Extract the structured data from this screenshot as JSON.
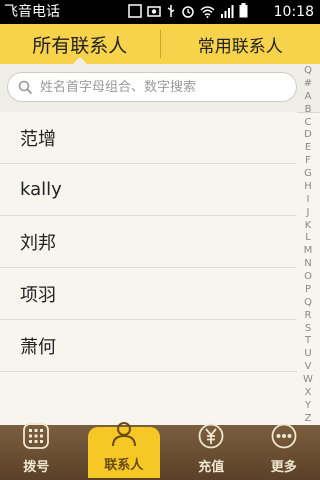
{
  "status_bar": {
    "carrier": "飞音电话",
    "time": "10:18",
    "icons": [
      "usb-icon",
      "alarm-icon",
      "wifi-icon",
      "signal-icon",
      "battery-icon"
    ]
  },
  "tabs": [
    {
      "label": "所有联系人",
      "active": true
    },
    {
      "label": "常用联系人",
      "active": false
    }
  ],
  "search": {
    "placeholder": "姓名首字母组合、数字搜索",
    "value": ""
  },
  "contacts": [
    {
      "name": "范增"
    },
    {
      "name": "kally"
    },
    {
      "name": "刘邦"
    },
    {
      "name": "项羽"
    },
    {
      "name": "萧何"
    }
  ],
  "index_letters": [
    "Q",
    "#",
    "A",
    "B",
    "C",
    "D",
    "E",
    "F",
    "G",
    "H",
    "I",
    "J",
    "K",
    "L",
    "M",
    "N",
    "O",
    "P",
    "Q",
    "R",
    "S",
    "T",
    "U",
    "V",
    "W",
    "X",
    "Y",
    "Z"
  ],
  "bottom_nav": [
    {
      "label": "拨号",
      "icon": "dialpad-icon",
      "active": false
    },
    {
      "label": "联系人",
      "icon": "person-icon",
      "active": true
    },
    {
      "label": "充值",
      "icon": "yuan-icon",
      "active": false
    },
    {
      "label": "更多",
      "icon": "more-icon",
      "active": false
    }
  ],
  "colors": {
    "tab_bar": "#f7d24b",
    "bottom_nav": "#6b4e32",
    "bottom_nav_active": "#f5c826"
  }
}
